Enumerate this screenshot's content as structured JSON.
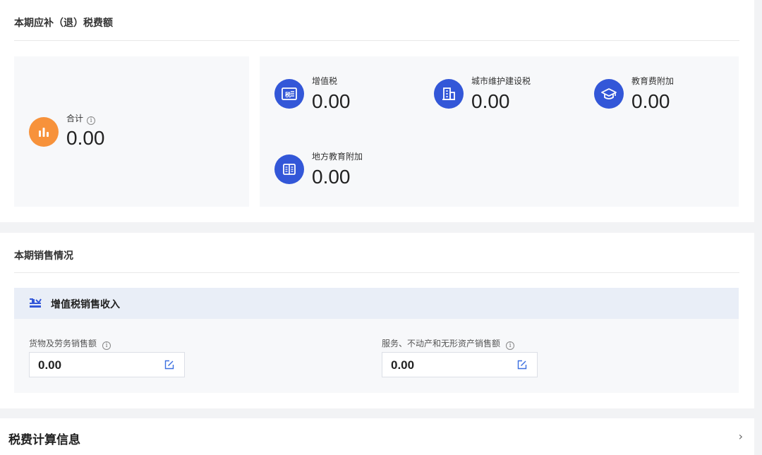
{
  "summary": {
    "title": "本期应补（退）税费额",
    "total": {
      "label": "合计",
      "value": "0.00",
      "icon": "bar-chart-icon"
    },
    "taxes": [
      {
        "label": "增值税",
        "value": "0.00",
        "icon": "tax-document-icon"
      },
      {
        "label": "城市维护建设税",
        "value": "0.00",
        "icon": "building-icon"
      },
      {
        "label": "教育费附加",
        "value": "0.00",
        "icon": "graduation-cap-icon"
      },
      {
        "label": "地方教育附加",
        "value": "0.00",
        "icon": "book-icon"
      }
    ]
  },
  "sales": {
    "title": "本期销售情况",
    "vat_section_title": "增值税销售收入",
    "fields": [
      {
        "label": "货物及劳务销售额",
        "value": "0.00"
      },
      {
        "label": "服务、不动产和无形资产销售额",
        "value": "0.00"
      }
    ]
  },
  "calc": {
    "title": "税费计算信息",
    "chevron": "›"
  },
  "colors": {
    "accent_blue": "#3357d8",
    "accent_orange": "#f7923b",
    "card_bg": "#f7f8fa",
    "section_head_bg": "#e9eef7"
  }
}
